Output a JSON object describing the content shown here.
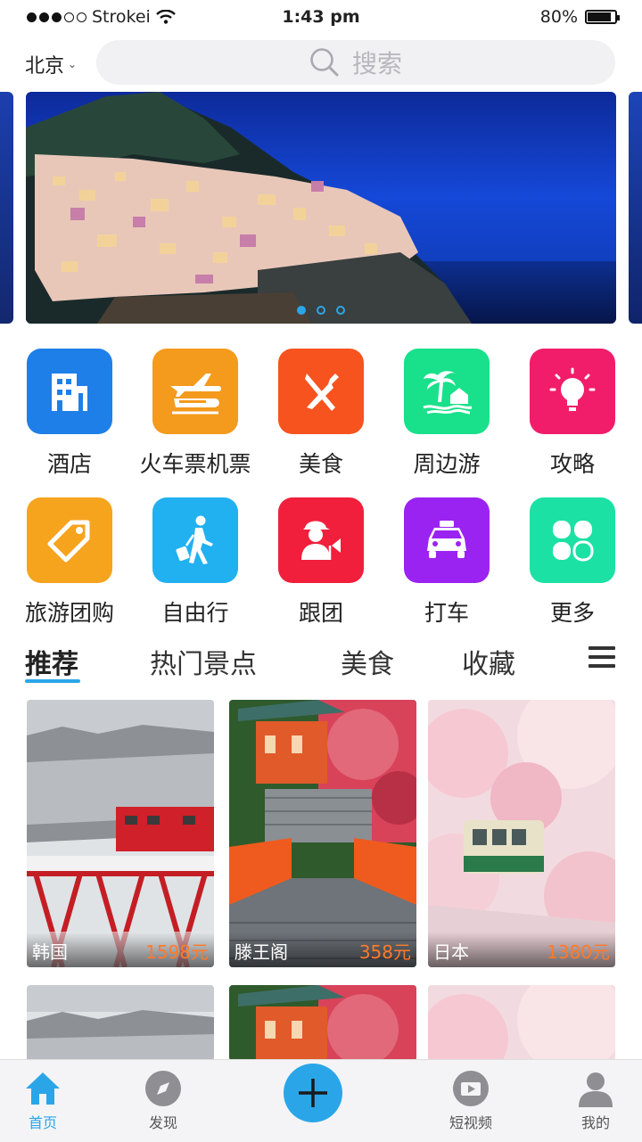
{
  "status": {
    "carrier": "Strokei",
    "time": "1:43 pm",
    "battery": "80%",
    "battery_level": 0.8
  },
  "header": {
    "city": "北京",
    "search_placeholder": "搜索"
  },
  "banner": {
    "pages": 3,
    "active_page": 1
  },
  "categories": [
    {
      "label": "酒店",
      "icon": "hotel-icon",
      "color": "#1f7fe8"
    },
    {
      "label": "火车票机票",
      "icon": "train-plane-icon",
      "color": "#f49a1c"
    },
    {
      "label": "美食",
      "icon": "food-icon",
      "color": "#f7531f"
    },
    {
      "label": "周边游",
      "icon": "island-icon",
      "color": "#19e08a"
    },
    {
      "label": "攻略",
      "icon": "lightbulb-icon",
      "color": "#f21d6a"
    },
    {
      "label": "旅游团购",
      "icon": "tag-icon",
      "color": "#f6a41e"
    },
    {
      "label": "自由行",
      "icon": "walker-icon",
      "color": "#21b1f0"
    },
    {
      "label": "跟团",
      "icon": "tour-guide-icon",
      "color": "#f11f3c"
    },
    {
      "label": "打车",
      "icon": "taxi-icon",
      "color": "#9b23f2"
    },
    {
      "label": "更多",
      "icon": "more-icon",
      "color": "#1be1a4"
    }
  ],
  "tabs": [
    "推荐",
    "热门景点",
    "美食",
    "收藏"
  ],
  "cards": [
    {
      "dest": "韩国",
      "price": "1598元"
    },
    {
      "dest": "滕王阁",
      "price": "358元"
    },
    {
      "dest": "日本",
      "price": "1380元"
    }
  ],
  "bottom_nav": [
    {
      "label": "首页",
      "icon": "home-icon"
    },
    {
      "label": "发现",
      "icon": "compass-icon"
    },
    {
      "label": "短视频",
      "icon": "video-icon"
    },
    {
      "label": "我的",
      "icon": "profile-icon"
    }
  ],
  "colors": {
    "accent": "#2aa6e8",
    "price": "#ff7a2a"
  }
}
